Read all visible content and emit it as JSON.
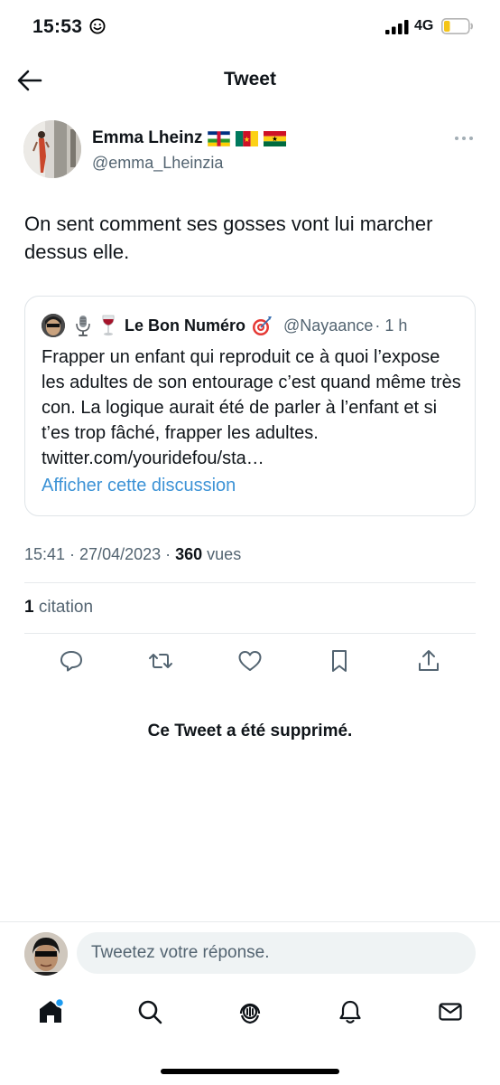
{
  "status_bar": {
    "time": "15:53",
    "network": "4G",
    "battery_level": 0.25,
    "battery_color": "#f5c518"
  },
  "header": {
    "title": "Tweet"
  },
  "tweet": {
    "author_name": "Emma Lheinz",
    "author_handle": "@emma_Lheinzia",
    "flags": [
      "central-african-republic-flag",
      "cameroon-flag",
      "ghana-flag"
    ],
    "text": "On sent comment ses gosses vont lui marcher dessus elle.",
    "time": "15:41 · 27/04/2023 · ",
    "views_count": "360",
    "views_label": " vues",
    "citation_count": "1",
    "citation_label": " citation"
  },
  "quoted_tweet": {
    "author_name": "Le Bon Numéro",
    "author_handle": "@Nayaance",
    "age": "· 1 h",
    "emojis": [
      "microphone-emoji",
      "wine-glass-emoji",
      "dart-target-emoji"
    ],
    "text": "Frapper un enfant qui reproduit ce à quoi l’expose les adultes de son entourage c’est quand même très con. La logique aurait été de parler à l’enfant et si t’es trop fâché, frapper les adultes. twitter.com/youridefou/sta…",
    "show_thread_link": "Afficher cette discussion"
  },
  "deleted_notice": "Ce Tweet a été supprimé.",
  "reply": {
    "placeholder": "Tweetez votre réponse."
  },
  "colors": {
    "accent": "#1d9bf0",
    "link": "#3d93d6",
    "secondary_text": "#536471",
    "border": "#dfe4e8"
  },
  "tabbar": {
    "items": [
      "home-icon",
      "search-icon",
      "spaces-icon",
      "notifications-icon",
      "messages-icon"
    ]
  }
}
